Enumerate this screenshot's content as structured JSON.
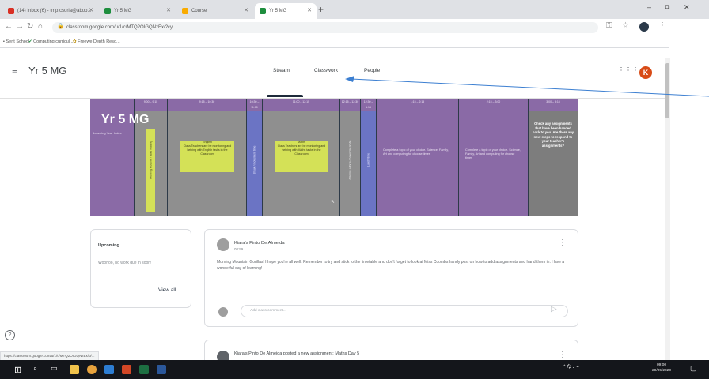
{
  "browser": {
    "tabs": [
      {
        "label": "(14) Inbox (6) - tmp.csoria@aboo...",
        "fav_color": "#d93025",
        "active": false
      },
      {
        "label": "Yr 5 MG",
        "fav_color": "#1e8e3e",
        "active": false
      },
      {
        "label": "Course",
        "fav_color": "#f9ab00",
        "active": false
      },
      {
        "label": "Yr 5 MG",
        "fav_color": "#1e8e3e",
        "active": true
      }
    ],
    "new_tab": "+",
    "window_controls": {
      "minimize": "–",
      "maximize": "⧉",
      "close": "✕"
    },
    "url": "classroom.google.com/u/1/c/MTQ2OIGQNzEx/?cy",
    "bookmarks": [
      "Sent School",
      "Computing curricul...",
      "Freewe Depth Reso..."
    ]
  },
  "app": {
    "title": "Yr 5 MG",
    "tabs": [
      "Stream",
      "Classwork",
      "People"
    ],
    "active_tab": "Stream",
    "avatar_letter": "K",
    "avatar_color": "#d84b16"
  },
  "banner": {
    "title": "Yr 5 MG",
    "tag": "Learning Year Index",
    "columns": [
      {
        "head": "",
        "kind": "label"
      },
      {
        "head": "9:00 – 9:15",
        "kind": "vertical",
        "text": "Morning Routine / daily reading"
      },
      {
        "head": "9:15 – 10:30",
        "kind": "yellow",
        "text": "English\nClass Teachers are be monitoring and helping with English tasks in the Classroom"
      },
      {
        "head": "10:30 – 11:00",
        "kind": "vertical-blue",
        "text": "Break / movement time"
      },
      {
        "head": "11:00 – 12:15",
        "kind": "yellow",
        "text": "Maths\nClass Teachers are be monitoring and helping with Maths tasks in the Classroom"
      },
      {
        "head": "12:15 – 12:30",
        "kind": "vertical",
        "text": "Choose a form of exercise to do"
      },
      {
        "head": "12:30 – 1:15",
        "kind": "vertical-blue",
        "text": "Lunch time"
      },
      {
        "head": "1:15 – 2:15",
        "kind": "text",
        "text": "Complete a topic of your choice. Science, Family, Art and computing for choose times"
      },
      {
        "head": "2:15 – 3:00",
        "kind": "text",
        "text": "Complete a topic of your choice. Science, Family, Art and computing for choose times"
      },
      {
        "head": "3:00 – 3:15",
        "kind": "bold",
        "text": "Check any assignments that have been handed back to you. Are there any next steps to respond to your teacher's assignments?"
      }
    ]
  },
  "upcoming": {
    "title": "Upcoming",
    "text": "Woohoo, no work due in soon!",
    "view_all": "View all"
  },
  "post": {
    "author": "Kiara's Pinto De Almeida",
    "time": "08:59",
    "body": "Morning Mountain Gorillas! I hope you're all well. Remember to try and stick to the timetable and don't forget to look at Miss Coombs handy post on how to add assignments and hand them in. Have a wonderful day of learning!",
    "comment_placeholder": "Add class comment..."
  },
  "post2": {
    "text": "Kiara's Pinto De Almeida posted a new assignment: Maths Day 5"
  },
  "status_url": "https://classroom.google.com/u/1/c/MTQ2OIGQNzEx/p/...",
  "taskbar": {
    "apps": [
      {
        "name": "file-explorer",
        "color": "#f0c24b"
      },
      {
        "name": "chrome",
        "color": "#e8a33d"
      },
      {
        "name": "store",
        "color": "#2d7dd2"
      },
      {
        "name": "powerpoint",
        "color": "#d24726"
      },
      {
        "name": "excel",
        "color": "#1d6f42"
      },
      {
        "name": "word",
        "color": "#2b579a"
      }
    ],
    "tray": "^ 🗘 ♪ ⌁",
    "time": "09:00",
    "date": "20/05/2020"
  },
  "annotation_color": "#3c7fd1"
}
